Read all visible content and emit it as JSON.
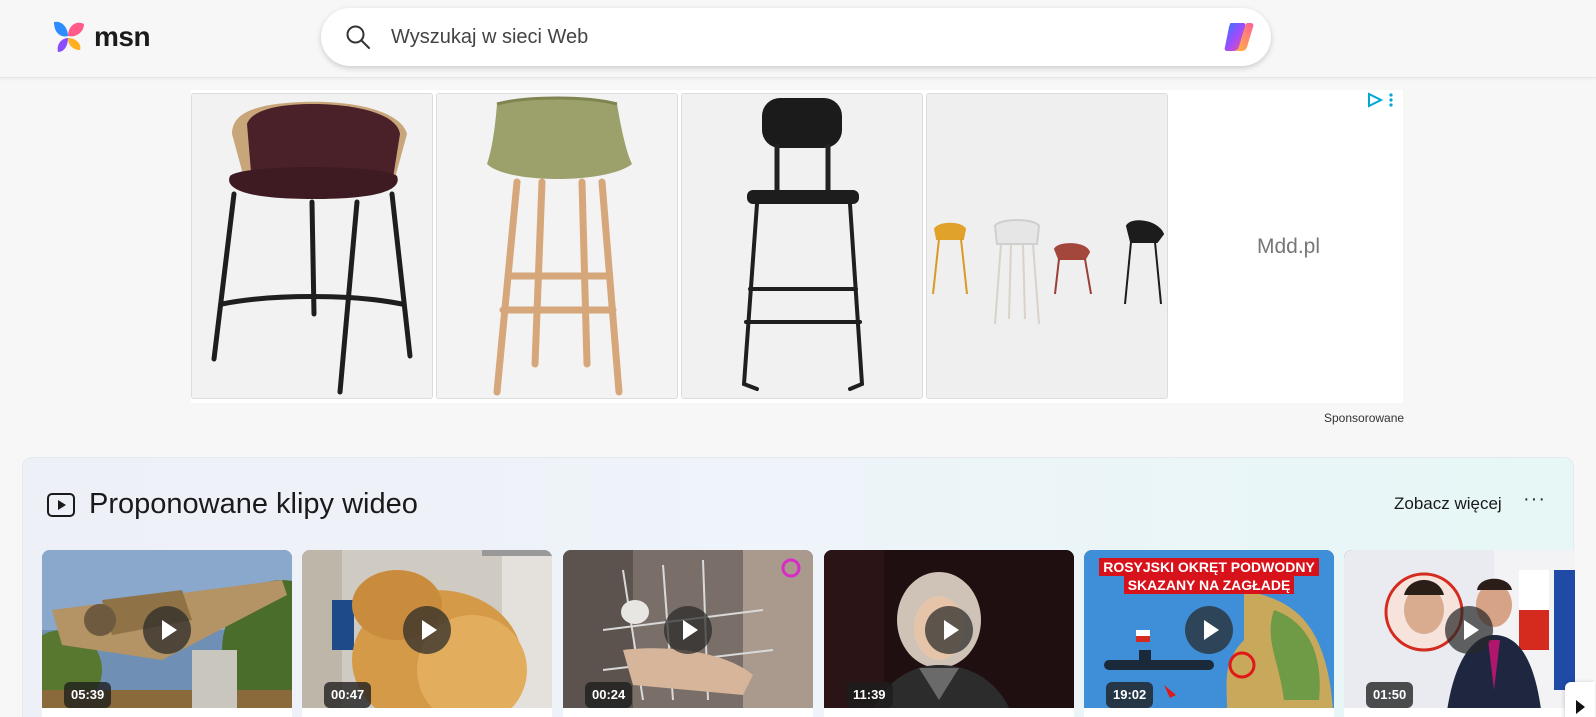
{
  "header": {
    "logo_text": "msn",
    "search_placeholder": "Wyszukaj w sieci Web"
  },
  "ad": {
    "brand": "Mdd.pl",
    "sponsored_label": "Sponsorowane"
  },
  "videos": {
    "title": "Proponowane klipy wideo",
    "see_more_label": "Zobacz więcej",
    "more_label": "···",
    "cards": [
      {
        "duration": "05:39"
      },
      {
        "duration": "00:47"
      },
      {
        "duration": "00:24"
      },
      {
        "duration": "11:39"
      },
      {
        "duration": "19:02",
        "overlay_line1": "ROSYJSKI OKRĘT PODWODNY",
        "overlay_line2": "SKAZANY NA ZAGŁADĘ"
      },
      {
        "duration": "01:50"
      }
    ]
  },
  "colors": {
    "accent": "#0078d4",
    "ad_choices": "#00a6d6"
  }
}
